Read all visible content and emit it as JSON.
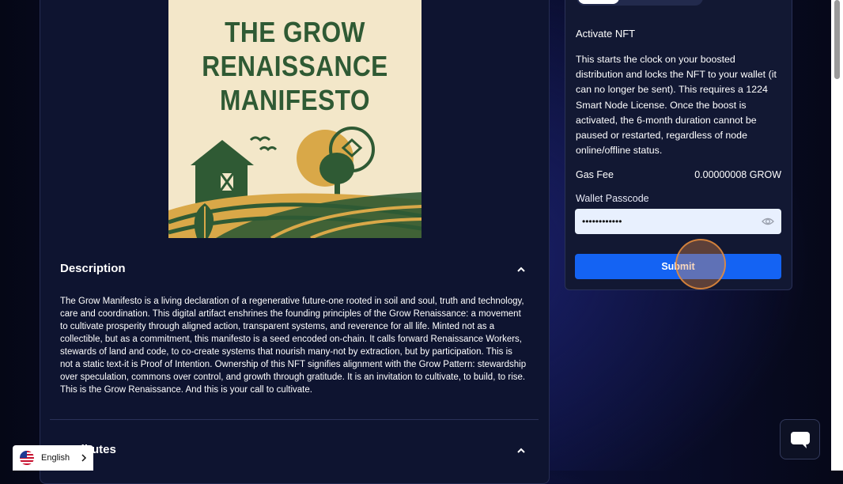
{
  "nft": {
    "title": "THE GROW\nRENAISSANCE\nMANIFESTO"
  },
  "description": {
    "heading": "Description",
    "text": "The Grow Manifesto is a living declaration of a regenerative future-one rooted in soil and soul, truth and technology, care and coordination. This digital artifact enshrines the founding principles of the Grow Renaissance: a movement to cultivate prosperity through aligned action, transparent systems, and reverence for all life. Minted not as a collectible, but as a commitment, this manifesto is a seed encoded on-chain. It calls forward Renaissance Workers, stewards of land and code, to co-create systems that nourish many-not by extraction, but by participation. This is not a static text-it is Proof of Intention. Ownership of this NFT signifies alignment with the Grow Pattern: stewardship over speculation, commons over control, and growth through gratitude. It is an invitation to cultivate, to build, to rise. This is the Grow Renaissance. And this is your call to cultivate."
  },
  "attributes": {
    "heading": "Attributes"
  },
  "activate": {
    "title": "Activate NFT",
    "body": "This starts the clock on your boosted distribution and locks the NFT to your wallet (it can no longer be sent). This requires a 1224 Smart Node License. Once the boost is activated, the 6-month duration cannot be paused or restarted, regardless of node online/offline status.",
    "gas_fee_label": "Gas Fee",
    "gas_fee_value": "0.00000008 GROW",
    "passcode_label": "Wallet Passcode",
    "passcode_value": "••••••••••••",
    "submit_label": "Submit"
  },
  "language": {
    "label": "English"
  },
  "icons": {
    "collapse": "chevron-up-icon",
    "reveal": "eye-icon",
    "chat": "chat-bubble-icon",
    "language_flag": "us-flag-icon",
    "language_arrow": "chevron-right-icon"
  },
  "colors": {
    "accent": "#1463f3",
    "artwork_green": "#2f5a34",
    "artwork_gold": "#d9a848"
  }
}
